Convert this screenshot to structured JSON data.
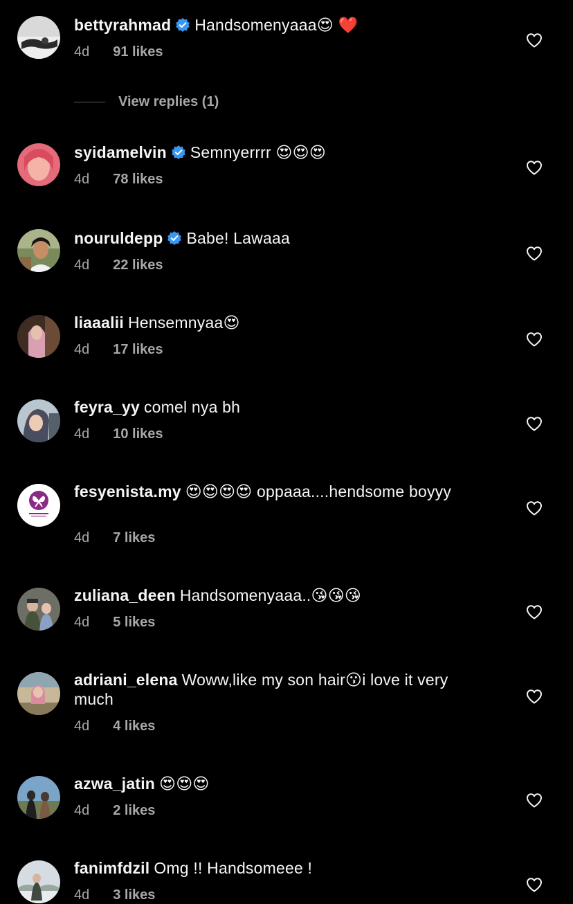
{
  "comments": [
    {
      "username": "bettyrahmad",
      "verified": true,
      "text": "Handsomenyaaa😍 ❤️",
      "time": "4d",
      "likes": "91 likes"
    },
    {
      "username": "syidamelvin",
      "verified": true,
      "text": "Semnyerrrr 😍😍😍",
      "time": "4d",
      "likes": "78 likes"
    },
    {
      "username": "nouruldepp",
      "verified": true,
      "text": "Babe! Lawaaa",
      "time": "4d",
      "likes": "22 likes"
    },
    {
      "username": "liaaalii",
      "verified": false,
      "text": "Hensemnyaa😍",
      "time": "4d",
      "likes": "17 likes"
    },
    {
      "username": "feyra_yy",
      "verified": false,
      "text": "comel nya bh",
      "time": "4d",
      "likes": "10 likes"
    },
    {
      "username": "fesyenista.my",
      "verified": false,
      "text": "😍😍😍😍 oppaaa....hendsome boyyy",
      "time": "4d",
      "likes": "7 likes"
    },
    {
      "username": "zuliana_deen",
      "verified": false,
      "text": "Handsomenyaaa..😘😘😘",
      "time": "4d",
      "likes": "5 likes"
    },
    {
      "username": "adriani_elena",
      "verified": false,
      "text": "Woww,like my son hair😗i love it very much",
      "time": "4d",
      "likes": "4 likes"
    },
    {
      "username": "azwa_jatin",
      "verified": false,
      "text": "😍😍😍",
      "time": "4d",
      "likes": "2 likes"
    },
    {
      "username": "fanimfdzil",
      "verified": false,
      "text": "Omg !! Handsomeee !",
      "time": "4d",
      "likes": "3 likes"
    }
  ],
  "view_replies": "View replies (1)",
  "icons": {
    "verified": "verified-badge-icon",
    "like": "heart-outline-icon"
  },
  "colors": {
    "background": "#000000",
    "text": "#f5f5f5",
    "secondary": "#a8a8a8",
    "verified": "#3897f0"
  }
}
